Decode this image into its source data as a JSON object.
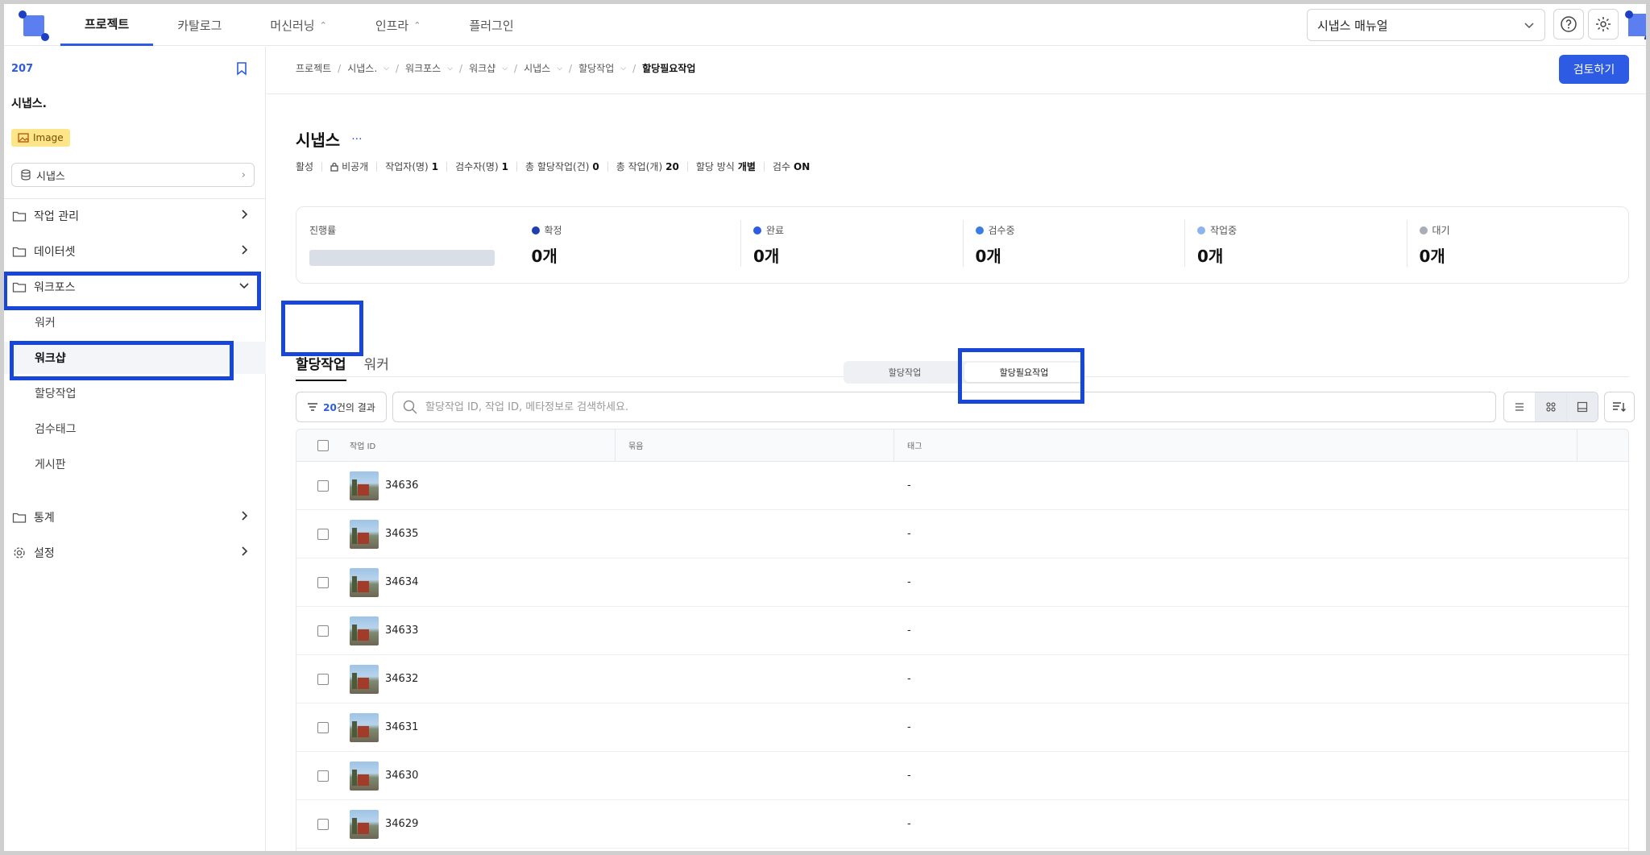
{
  "topnav": {
    "items": [
      {
        "label": "프로젝트",
        "active": true,
        "dropdown": false
      },
      {
        "label": "카탈로그",
        "active": false,
        "dropdown": false
      },
      {
        "label": "머신러닝",
        "active": false,
        "dropdown": true
      },
      {
        "label": "인프라",
        "active": false,
        "dropdown": true
      },
      {
        "label": "플러그인",
        "active": false,
        "dropdown": false
      }
    ],
    "manual_select": "시냅스 매뉴얼",
    "help_icon": "help-circle-icon",
    "settings_icon": "gear-icon"
  },
  "sidebar": {
    "project_id": "207",
    "project_name": "시냅스.",
    "badge": "Image",
    "dataset_select": "시냅스",
    "menu": [
      {
        "label": "작업 관리",
        "icon": "folder-icon",
        "expanded": false
      },
      {
        "label": "데이터셋",
        "icon": "folder-icon",
        "expanded": false
      },
      {
        "label": "워크포스",
        "icon": "folder-open-icon",
        "expanded": true
      },
      {
        "label": "통계",
        "icon": "folder-icon",
        "expanded": false
      },
      {
        "label": "설정",
        "icon": "gear-icon",
        "expanded": false
      }
    ],
    "submenu": [
      "워커",
      "워크샵",
      "할당작업",
      "검수태그",
      "게시판"
    ],
    "selected_sub": "워크샵"
  },
  "breadcrumb": {
    "items": [
      "프로젝트",
      "시냅스.",
      "워크포스",
      "워크샵",
      "시냅스",
      "할당작업"
    ],
    "current": "할당필요작업"
  },
  "review_button": "검토하기",
  "page": {
    "title": "시냅스",
    "more": "···",
    "status": "활성",
    "visibility": "비공개",
    "meta": [
      {
        "label": "작업자(명)",
        "value": "1"
      },
      {
        "label": "검수자(명)",
        "value": "1"
      },
      {
        "label": "총 할당작업(건)",
        "value": "0"
      },
      {
        "label": "총 작업(개)",
        "value": "20"
      },
      {
        "label": "할당 방식",
        "value": "개별"
      },
      {
        "label": "검수",
        "value": "ON"
      }
    ]
  },
  "stats": {
    "progress_label": "진행률",
    "progress_value": 0,
    "items": [
      {
        "label": "확정",
        "value": "0개",
        "color": "#1e40af"
      },
      {
        "label": "완료",
        "value": "0개",
        "color": "#2d5be3"
      },
      {
        "label": "검수중",
        "value": "0개",
        "color": "#3b7de8"
      },
      {
        "label": "작업중",
        "value": "0개",
        "color": "#8db4ee"
      },
      {
        "label": "대기",
        "value": "0개",
        "color": "#a8adb6"
      }
    ]
  },
  "tabs": [
    {
      "label": "할당작업",
      "active": true
    },
    {
      "label": "워커",
      "active": false
    }
  ],
  "segment": [
    {
      "label": "할당작업",
      "active": false
    },
    {
      "label": "할당필요작업",
      "active": true
    }
  ],
  "toolbar": {
    "result_count": "20",
    "result_suffix": "건의 결과",
    "search_placeholder": "할당작업 ID, 작업 ID, 메타정보로 검색하세요."
  },
  "table": {
    "headers": [
      "작업 ID",
      "묶음",
      "태그"
    ],
    "rows": [
      {
        "id": "34636",
        "group": "",
        "tag": "-"
      },
      {
        "id": "34635",
        "group": "",
        "tag": "-"
      },
      {
        "id": "34634",
        "group": "",
        "tag": "-"
      },
      {
        "id": "34633",
        "group": "",
        "tag": "-"
      },
      {
        "id": "34632",
        "group": "",
        "tag": "-"
      },
      {
        "id": "34631",
        "group": "",
        "tag": "-"
      },
      {
        "id": "34630",
        "group": "",
        "tag": "-"
      },
      {
        "id": "34629",
        "group": "",
        "tag": "-"
      }
    ]
  },
  "colors": {
    "accent": "#2d5be3",
    "highlight": "#1746d8"
  }
}
